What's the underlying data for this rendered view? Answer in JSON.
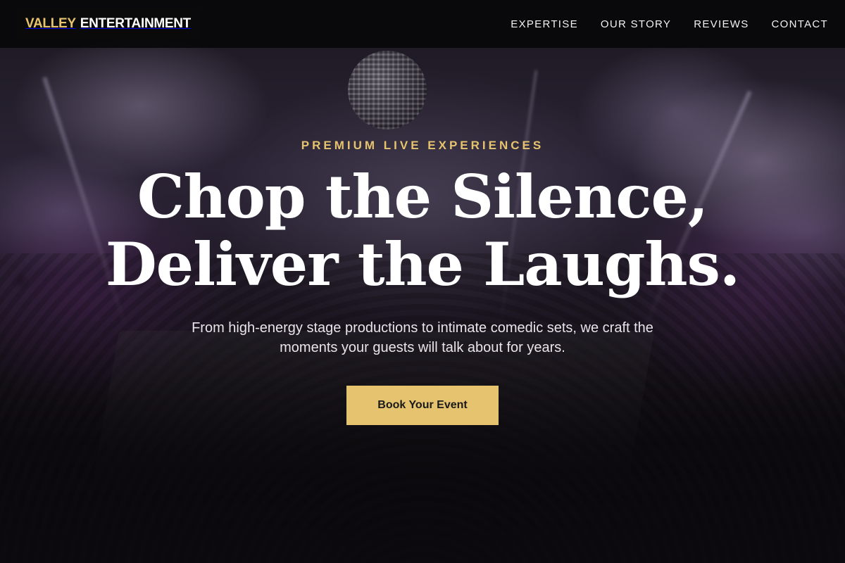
{
  "brand": {
    "accent_word": "VALLEY",
    "main_word": "ENTERTAINMENT",
    "accent_color": "#e6c36f"
  },
  "nav": {
    "items": [
      {
        "label": "EXPERTISE"
      },
      {
        "label": "OUR STORY"
      },
      {
        "label": "REVIEWS"
      },
      {
        "label": "CONTACT"
      }
    ]
  },
  "hero": {
    "eyebrow": "PREMIUM LIVE EXPERIENCES",
    "headline_line1": "Chop the Silence,",
    "headline_line2": "Deliver the Laughs.",
    "subtext": "From high-energy stage productions to intimate comedic sets, we craft the moments your guests will talk about for years.",
    "cta_label": "Book Your Event",
    "cta_color": "#e6c36f"
  }
}
